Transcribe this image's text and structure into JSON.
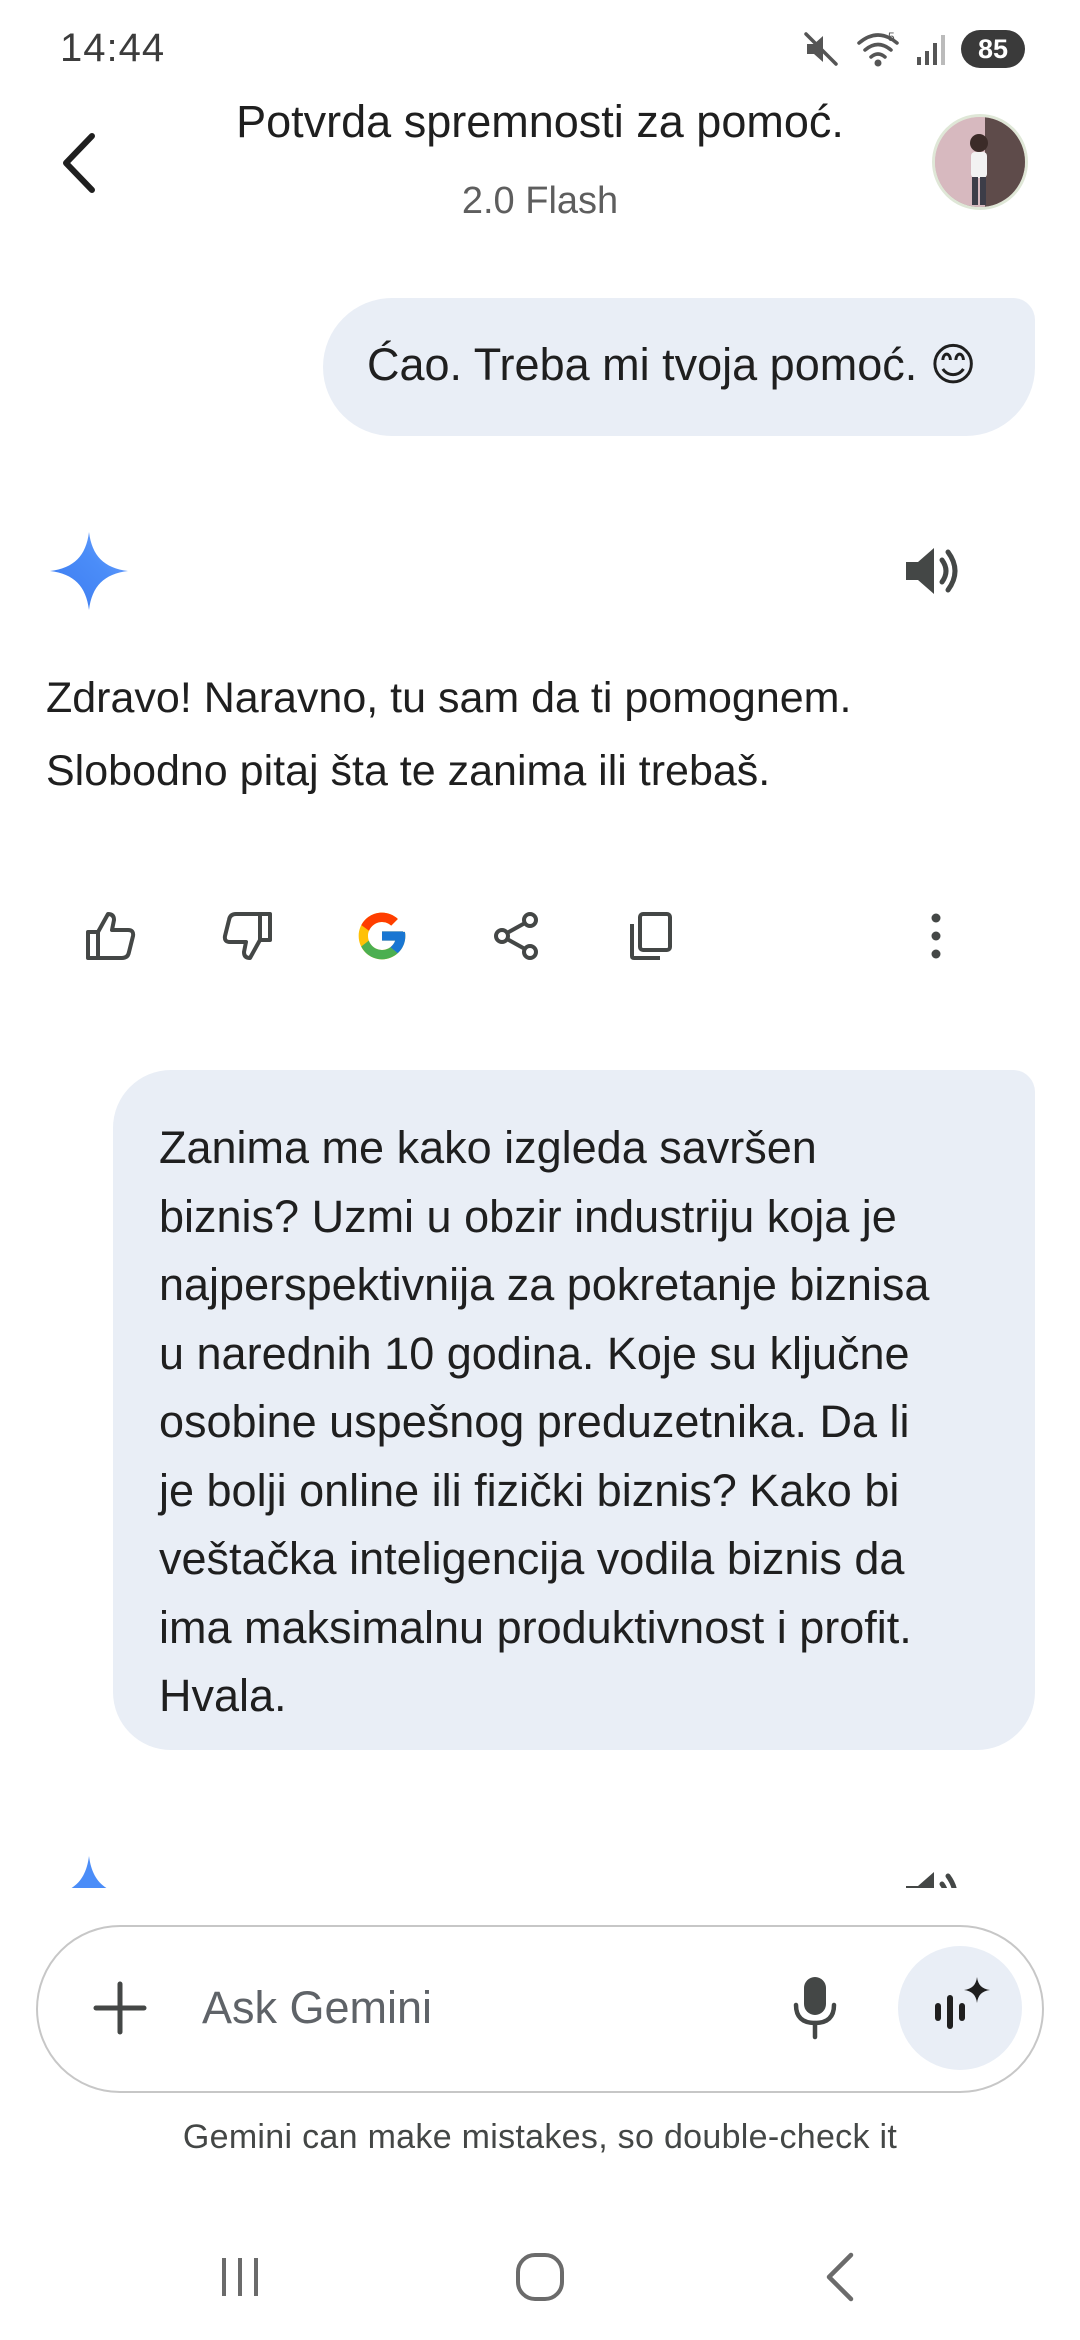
{
  "status_bar": {
    "time": "14:44",
    "battery": "85",
    "icons": [
      "mute-icon",
      "wifi-icon",
      "signal-icon",
      "battery-icon"
    ]
  },
  "header": {
    "title": "Potvrda spremnosti za pomoć.",
    "model": "2.0 Flash",
    "icons": [
      "back-arrow-icon",
      "avatar"
    ]
  },
  "messages": {
    "user_1": "Ćao. Treba mi tvoja pomoć. 😊",
    "model_1_line_1": "Zdravo! Naravno, tu sam da ti pomognem.",
    "model_1_line_2": "Slobodno pitaj šta te zanima ili trebaš.",
    "user_2": [
      "Zanima me kako izgleda savršen",
      "biznis? Uzmi u obzir industriju koja je",
      "najperspektivnija za pokretanje biznisa",
      "u narednih 10 godina. Koje su ključne",
      "osobine uspešnog preduzetnika. Da li",
      "je bolji online ili fizički biznis? Kako bi",
      "veštačka inteligencija vodila biznis da",
      "ima maksimalnu produktivnost i profit.",
      "Hvala."
    ]
  },
  "response_actions": [
    "thumbs-up-icon",
    "thumbs-down-icon",
    "google-icon",
    "share-icon",
    "copy-icon",
    "more-vert-icon"
  ],
  "composer": {
    "placeholder": "Ask Gemini",
    "icons": [
      "plus-icon",
      "mic-icon",
      "gemini-live-icon"
    ],
    "disclaimer": "Gemini can make mistakes, so double-check it"
  },
  "nav_bar": {
    "icons": [
      "recent-apps-icon",
      "home-icon",
      "back-icon"
    ]
  },
  "colors": {
    "bubble": "#e9eef6",
    "text": "#1f1f1f",
    "muted": "#5e5e5e",
    "gemini_blue": "#4285f4"
  }
}
